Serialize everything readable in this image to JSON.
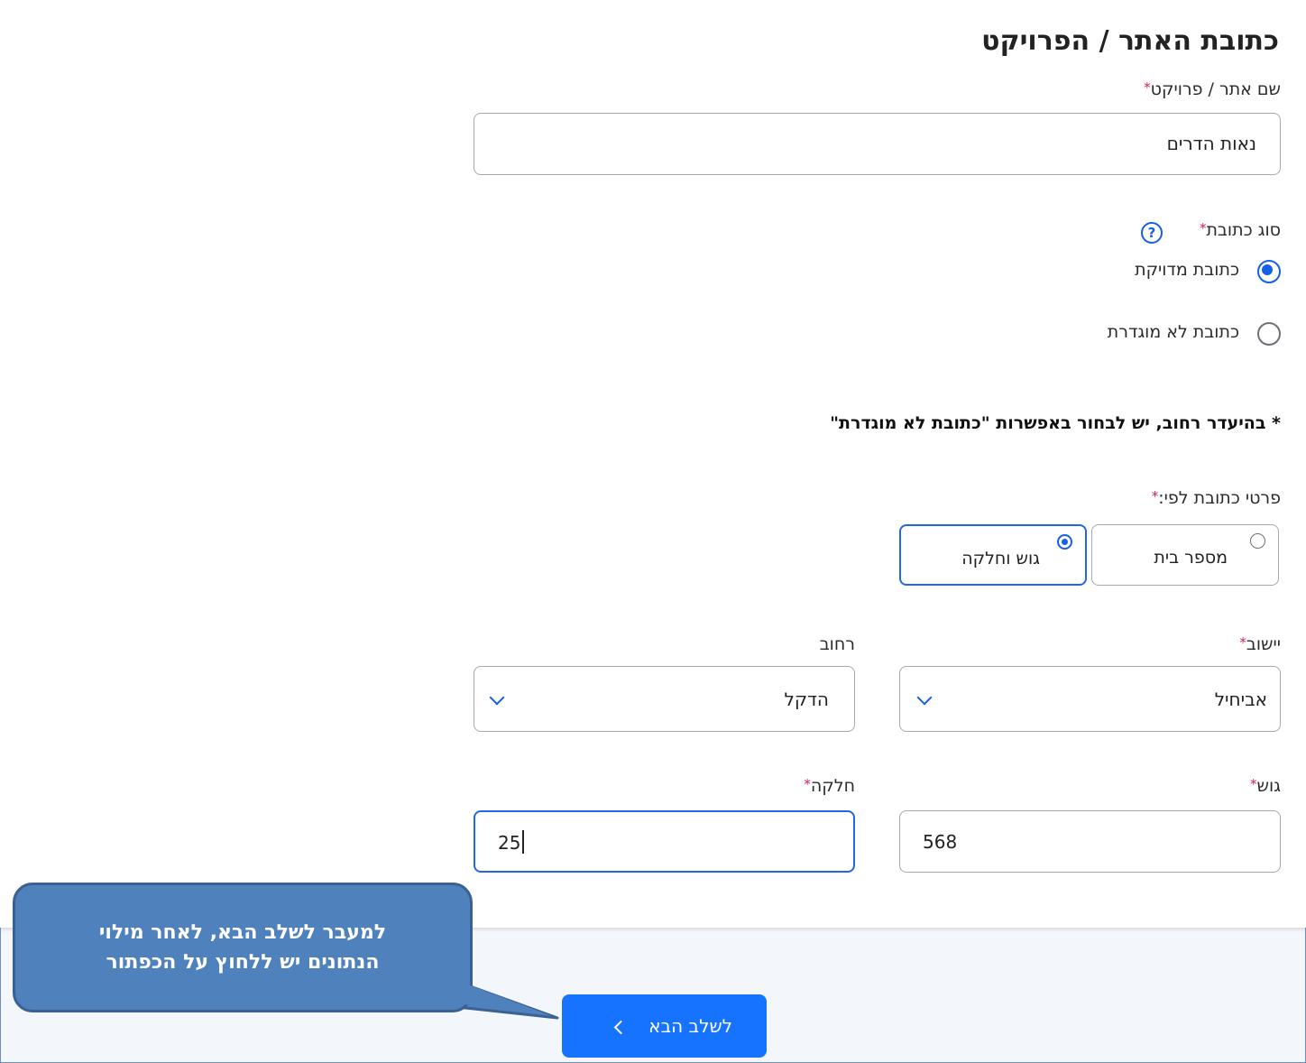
{
  "section_title": "כתובת האתר / הפרויקט",
  "required_mark": "*",
  "site_name": {
    "label": "שם אתר / פרויקט",
    "value": "נאות הדרים"
  },
  "address_type": {
    "label": "סוג כתובת",
    "help_icon": "?",
    "options": [
      {
        "label": "כתובת מדויקת",
        "selected": true
      },
      {
        "label": "כתובת לא מוגדרת",
        "selected": false
      }
    ]
  },
  "note": "* בהיעדר רחוב, יש לבחור באפשרות \"כתובת לא מוגדרת\"",
  "address_details": {
    "label": "פרטי כתובת לפי:",
    "options": [
      {
        "label": "מספר בית",
        "selected": false
      },
      {
        "label": "גוש וחלקה",
        "selected": true
      }
    ]
  },
  "settlement": {
    "label": "יישוב",
    "value": "אביחיל"
  },
  "street": {
    "label": "רחוב",
    "value": "הדקל"
  },
  "block": {
    "label": "גוש",
    "value": "568"
  },
  "parcel": {
    "label": "חלקה",
    "value": "25"
  },
  "next_button": {
    "label": "לשלב הבא"
  },
  "callout": {
    "line1": "למעבר לשלב הבא, לאחר מילוי",
    "line2": "הנתונים יש ללחוץ על הכפתור"
  },
  "colors": {
    "accent": "#1560e8",
    "button": "#1573ff",
    "callout": "#4f81bd",
    "required": "#d6204c"
  },
  "icons": {
    "help": "question-circle-icon",
    "dropdown": "chevron-down-icon",
    "next": "chevron-left-icon"
  }
}
